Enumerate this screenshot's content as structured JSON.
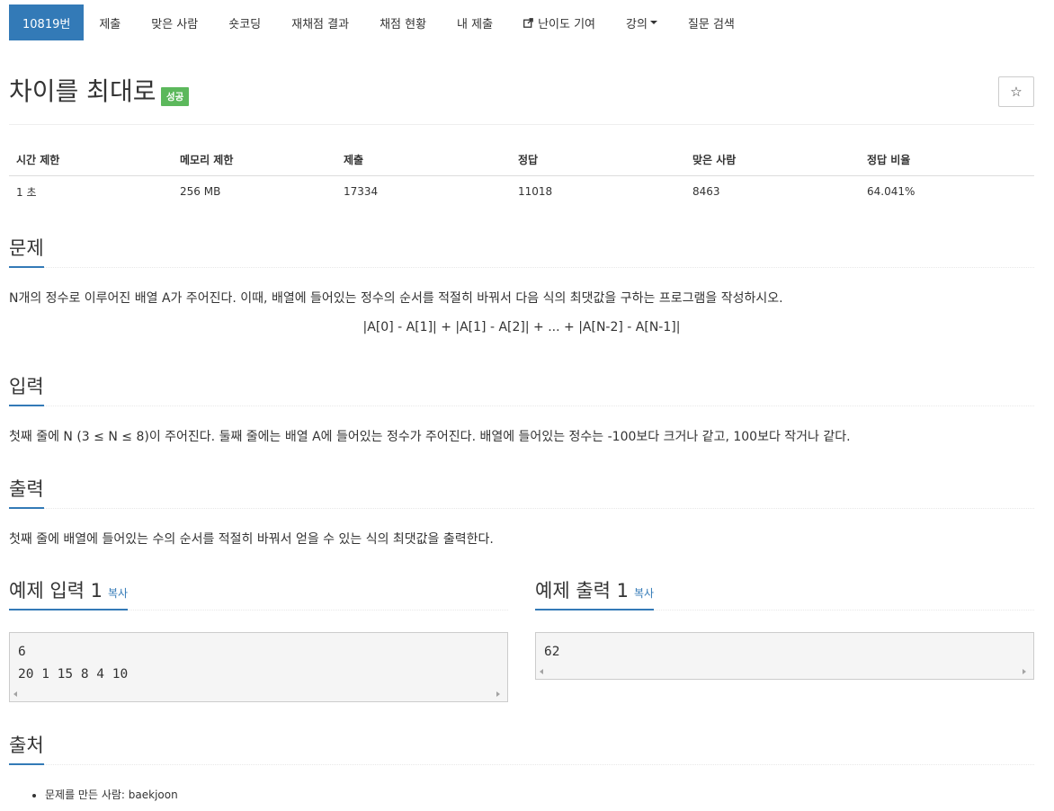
{
  "nav": {
    "items": [
      {
        "label": "10819번",
        "active": true
      },
      {
        "label": "제출"
      },
      {
        "label": "맞은 사람"
      },
      {
        "label": "숏코딩"
      },
      {
        "label": "재채점 결과"
      },
      {
        "label": "채점 현황"
      },
      {
        "label": "내 제출"
      },
      {
        "label": "난이도 기여",
        "icon": "external-link-icon"
      },
      {
        "label": "강의",
        "icon": "caret-down-icon"
      },
      {
        "label": "질문 검색"
      }
    ],
    "active_color": "#337ab7"
  },
  "problem": {
    "title": "차이를 최대로",
    "status_badge": "성공",
    "star_icon": "☆"
  },
  "stats": {
    "headers": [
      "시간 제한",
      "메모리 제한",
      "제출",
      "정답",
      "맞은 사람",
      "정답 비율"
    ],
    "values": [
      "1 초",
      "256 MB",
      "17334",
      "11018",
      "8463",
      "64.041%"
    ]
  },
  "sections": {
    "description": {
      "heading": "문제",
      "text": "N개의 정수로 이루어진 배열 A가 주어진다. 이때, 배열에 들어있는 정수의 순서를 적절히 바꿔서 다음 식의 최댓값을 구하는 프로그램을 작성하시오.",
      "formula": "|A[0] - A[1]| + |A[1] - A[2]| + ... + |A[N-2] - A[N-1]|"
    },
    "input": {
      "heading": "입력",
      "text": "첫째 줄에 N (3 ≤ N ≤ 8)이 주어진다. 둘째 줄에는 배열 A에 들어있는 정수가 주어진다. 배열에 들어있는 정수는 -100보다 크거나 같고, 100보다 작거나 같다."
    },
    "output": {
      "heading": "출력",
      "text": "첫째 줄에 배열에 들어있는 수의 순서를 적절히 바꿔서 얻을 수 있는 식의 최댓값을 출력한다."
    },
    "source": {
      "heading": "출처",
      "items": [
        "문제를 만든 사람: baekjoon"
      ]
    }
  },
  "samples": {
    "input": {
      "heading": "예제 입력 1",
      "copy_label": "복사",
      "lines": [
        "6",
        "20 1 15 8 4 10"
      ]
    },
    "output": {
      "heading": "예제 출력 1",
      "copy_label": "복사",
      "lines": [
        "62"
      ]
    }
  }
}
